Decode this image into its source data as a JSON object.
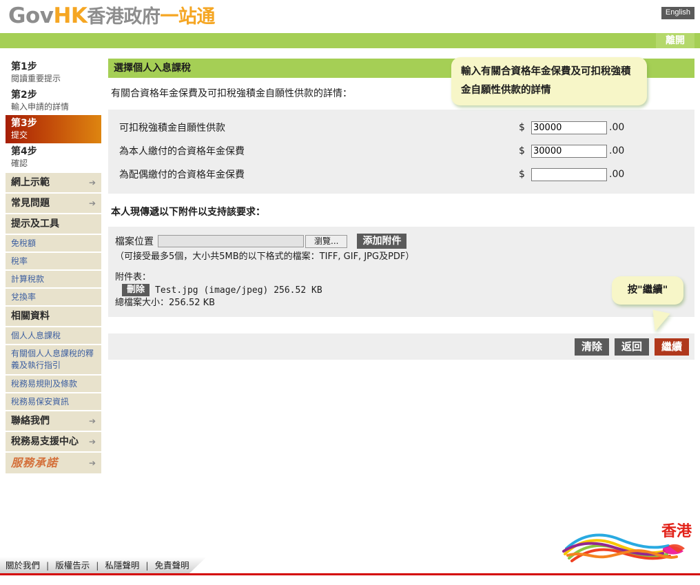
{
  "header": {
    "logo": {
      "gov": "Gov",
      "hk": "HK",
      "cn_gray": "香港政府",
      "cn_orange": "一站通"
    },
    "english_button": "English",
    "exit_button": "離開"
  },
  "sidebar": {
    "steps": [
      {
        "num": "第1步",
        "sub": "閱讀重要提示",
        "active": false
      },
      {
        "num": "第2步",
        "sub": "輸入申請的詳情",
        "active": false
      },
      {
        "num": "第3步",
        "sub": "提交",
        "active": true
      },
      {
        "num": "第4步",
        "sub": "確認",
        "active": false
      }
    ],
    "sections": [
      {
        "label": "網上示範",
        "arrow": "arrow-right-icon"
      },
      {
        "label": "常見問題",
        "arrow": "arrow-right-icon"
      },
      {
        "label": "提示及工具",
        "arrow": ""
      }
    ],
    "tools_links": [
      "免稅額",
      "稅率",
      "計算稅款",
      "兌換率"
    ],
    "related_header": "相關資料",
    "related_links": [
      "個人人息課稅",
      "有關個人人息課稅的釋義及執行指引",
      "稅務易規則及條款",
      "稅務易保安資訊"
    ],
    "contact_header": "聯絡我們",
    "support_header": "稅務易支援中心",
    "pledge": "服務承諾"
  },
  "main": {
    "section_title": "選擇個人入息課稅",
    "intro": "有關合資格年金保費及可扣稅強積金自願性供款的詳情：",
    "fields": [
      {
        "label": "可扣稅強積金自願性供款",
        "currency": "$",
        "value": "30000",
        "cents": ".00"
      },
      {
        "label": "為本人繳付的合資格年金保費",
        "currency": "$",
        "value": "30000",
        "cents": ".00"
      },
      {
        "label": "為配偶繳付的合資格年金保費",
        "currency": "$",
        "value": "",
        "cents": ".00"
      }
    ],
    "attachment_heading": "本人現傳遞以下附件以支持該要求：",
    "file_label": "檔案位置",
    "file_path_value": "",
    "browse_button": "瀏覽...",
    "add_button": "添加附件",
    "formats_note": "（可接受最多5個，大小共5MB的以下格式的檔案：TIFF, GIF, JPG及PDF）",
    "list_label": "附件表：",
    "attachments": [
      {
        "delete_button": "刪除",
        "name": "Test.jpg (image/jpeg) 256.52 KB"
      }
    ],
    "total_size": "總檔案大小：256.52 KB",
    "actions": [
      {
        "label": "清除",
        "style": "grey"
      },
      {
        "label": "返回",
        "style": "grey"
      },
      {
        "label": "繼續",
        "style": "red"
      }
    ]
  },
  "callouts": [
    {
      "text": "輸入有關合資格年金保費及可扣稅強積金自願性供款的詳情"
    },
    {
      "text": "按\"繼續\""
    }
  ],
  "footer": {
    "links": [
      "關於我們",
      "版權告示",
      "私隱聲明",
      "免責聲明"
    ],
    "separator": "|",
    "brand_text": "香港",
    "brand_name": "brand-hong-kong-logo"
  },
  "colors": {
    "green_bar": "#a5cf55",
    "accent_orange": "#f5a623",
    "active_step_start": "#a61e06",
    "active_step_end": "#de8510",
    "continue_button": "#b0381c",
    "callout_bg": "#f7f6c8",
    "panel_bg": "#eeeeee",
    "sidebar_bg": "#e8e2cc",
    "footer_red_line": "#d40000"
  }
}
